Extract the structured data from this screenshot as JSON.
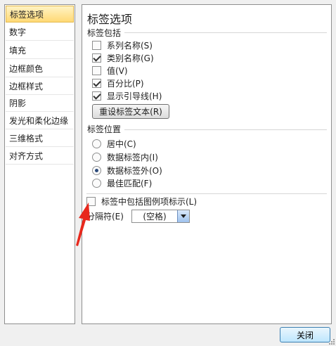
{
  "nav": {
    "items": [
      {
        "label": "标签选项",
        "selected": true
      },
      {
        "label": "数字",
        "selected": false
      },
      {
        "label": "填充",
        "selected": false
      },
      {
        "label": "边框颜色",
        "selected": false
      },
      {
        "label": "边框样式",
        "selected": false
      },
      {
        "label": "阴影",
        "selected": false
      },
      {
        "label": "发光和柔化边缘",
        "selected": false
      },
      {
        "label": "三维格式",
        "selected": false
      },
      {
        "label": "对齐方式",
        "selected": false
      }
    ]
  },
  "panel": {
    "title": "标签选项",
    "label_contains": {
      "heading": "标签包括",
      "options": [
        {
          "label": "系列名称(S)",
          "checked": false
        },
        {
          "label": "类别名称(G)",
          "checked": true
        },
        {
          "label": "值(V)",
          "checked": false
        },
        {
          "label": "百分比(P)",
          "checked": true
        },
        {
          "label": "显示引导线(H)",
          "checked": true
        }
      ],
      "reset_button": "重设标签文本(R)"
    },
    "label_position": {
      "heading": "标签位置",
      "options": [
        {
          "label": "居中(C)",
          "selected": false
        },
        {
          "label": "数据标签内(I)",
          "selected": false
        },
        {
          "label": "数据标签外(O)",
          "selected": true
        },
        {
          "label": "最佳匹配(F)",
          "selected": false
        }
      ]
    },
    "legend_key": {
      "label": "标签中包括图例项标示(L)",
      "checked": false
    },
    "separator": {
      "label": "分隔符(E)",
      "value": "(空格)"
    }
  },
  "footer": {
    "close_button": "关闭"
  },
  "colors": {
    "selection": "#ffd975",
    "annotation_arrow": "#e8281c"
  }
}
